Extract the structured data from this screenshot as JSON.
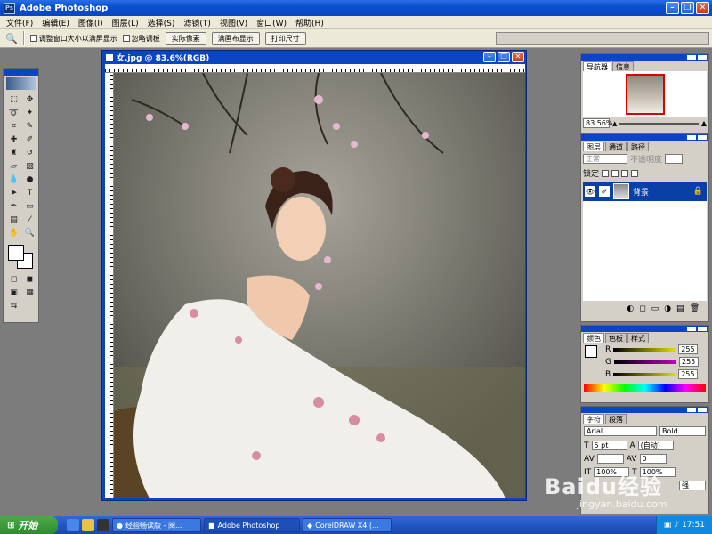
{
  "window": {
    "title": "Adobe Photoshop"
  },
  "menu": [
    "文件(F)",
    "编辑(E)",
    "图像(I)",
    "图层(L)",
    "选择(S)",
    "滤镜(T)",
    "视图(V)",
    "窗口(W)",
    "帮助(H)"
  ],
  "options": {
    "resize_label": "调整窗口大小以满屏显示",
    "ignore_label": "忽略调板",
    "actual_pixels": "实际像素",
    "fit_screen": "满画布显示",
    "print_size": "打印尺寸"
  },
  "document": {
    "title": "女.jpg @ 83.6%(RGB)"
  },
  "navigator": {
    "tabs": [
      "导航器",
      "信息"
    ],
    "zoom": "83.56%"
  },
  "layers": {
    "tabs": [
      "图层",
      "通道",
      "路径"
    ],
    "blend_mode": "正常",
    "opacity_label": "不透明度",
    "lock_label": "锁定",
    "layer_name": "背景"
  },
  "color": {
    "tabs": [
      "颜色",
      "色板",
      "样式"
    ],
    "channels": [
      {
        "label": "R",
        "value": "255",
        "color": "#e0e000"
      },
      {
        "label": "G",
        "value": "255",
        "color": "#c000c0"
      },
      {
        "label": "B",
        "value": "255",
        "color": "#e0e000"
      }
    ]
  },
  "character": {
    "tabs": [
      "字符",
      "段落"
    ],
    "font": "Arial",
    "style": "Bold",
    "size": "5 pt",
    "leading": "(自动)",
    "tracking": "0",
    "scale_v": "100%",
    "scale_h": "100%",
    "aa": "强"
  },
  "taskbar": {
    "start": "开始",
    "tasks": [
      "经验畅读版 - 阅...",
      "Adobe Photoshop",
      "CorelDRAW X4 (..."
    ],
    "time": "17:51"
  },
  "watermark": {
    "brand": "Baidu经验",
    "url": "jingyan.baidu.com"
  },
  "colors": {
    "title_blue": "#0b4fd0",
    "chrome": "#ece9d8",
    "panel": "#d4d0c8"
  }
}
